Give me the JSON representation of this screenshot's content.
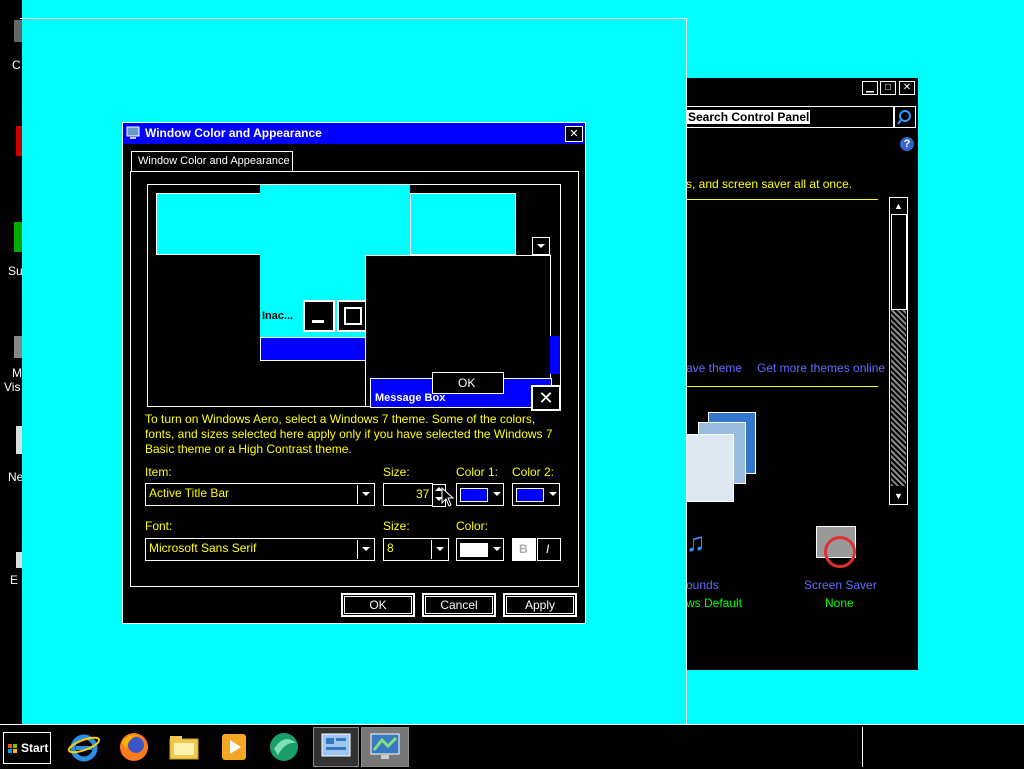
{
  "desktop": {
    "icon_labels": [
      "C",
      "Su",
      "M",
      "Vis",
      "Ne",
      "E"
    ]
  },
  "control_panel": {
    "search_placeholder": "Search Control Panel",
    "description_fragment": "s, and screen saver all at once.",
    "link_save_theme": "ave theme",
    "link_more_themes": "Get more themes online",
    "sounds_label": "ounds",
    "sounds_value": "ws Default",
    "screensaver_label": "Screen Saver",
    "screensaver_value": "None"
  },
  "dialog": {
    "title": "Window Color and Appearance",
    "tab": "Window Color and Appearance",
    "preview": {
      "inactive_label": "Inac...",
      "ok_label": "OK",
      "message_box_label": "Message Box"
    },
    "info_text": "To turn on Windows Aero, select a Windows 7 theme.  Some of the colors, fonts, and sizes selected here apply only if you have selected the Windows 7 Basic theme or a High Contrast theme.",
    "item_label": "Item:",
    "item_value": "Active Title Bar",
    "size_label": "Size:",
    "size_value": "37",
    "color1_label": "Color 1:",
    "color2_label": "Color 2:",
    "font_label": "Font:",
    "font_value": "Microsoft Sans Serif",
    "font_size_label": "Size:",
    "font_size_value": "8",
    "font_color_label": "Color:",
    "bold_label": "B",
    "italic_label": "I",
    "ok_button": "OK",
    "cancel_button": "Cancel",
    "apply_button": "Apply",
    "colors": {
      "color1": "#0000ff",
      "color2": "#0000ff",
      "font_color": "#ffffff",
      "title_bar": "#0000ff"
    }
  },
  "taskbar": {
    "start_label": "Start",
    "icons": [
      "internet-explorer-icon",
      "firefox-icon",
      "file-explorer-icon",
      "media-player-icon",
      "app-icon",
      "control-panel-icon",
      "display-settings-icon"
    ]
  }
}
